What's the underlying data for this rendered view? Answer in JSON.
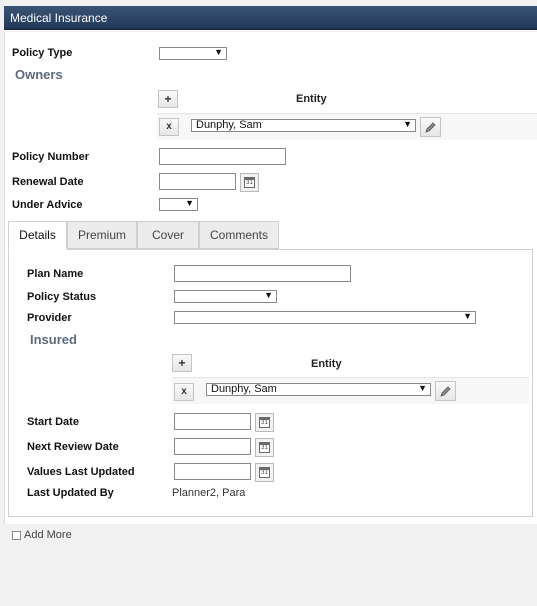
{
  "header": {
    "title": "Medical Insurance"
  },
  "form": {
    "policy_type_label": "Policy Type",
    "owners_heading": "Owners",
    "entity_label": "Entity",
    "owner_entity_value": "Dunphy, Sam",
    "policy_number_label": "Policy Number",
    "renewal_date_label": "Renewal Date",
    "under_advice_label": "Under Advice"
  },
  "tabs": [
    "Details",
    "Premium",
    "Cover",
    "Comments"
  ],
  "details": {
    "plan_name_label": "Plan Name",
    "policy_status_label": "Policy Status",
    "provider_label": "Provider",
    "insured_heading": "Insured",
    "entity_label": "Entity",
    "insured_entity_value": "Dunphy, Sam",
    "start_date_label": "Start Date",
    "next_review_date_label": "Next Review Date",
    "values_last_updated_label": "Values Last Updated",
    "last_updated_by_label": "Last Updated By",
    "last_updated_by_value": "Planner2, Para"
  },
  "footer": {
    "add_more_label": "Add More"
  },
  "icons": {
    "add": "plus-icon",
    "remove": "x-icon",
    "edit": "pencil-icon",
    "calendar": "calendar-icon",
    "calendar_day": "31"
  },
  "colors": {
    "titlebar": "#2c4466",
    "section_heading": "#5b6b7c"
  }
}
